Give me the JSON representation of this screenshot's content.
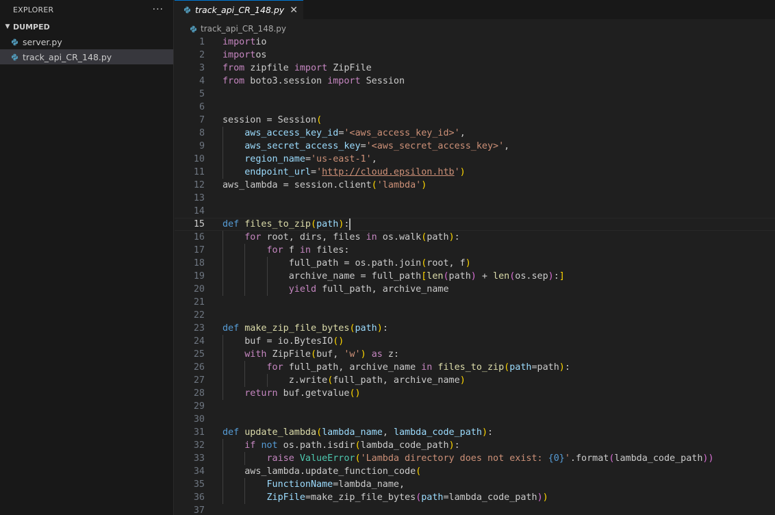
{
  "explorer": {
    "title": "EXPLORER",
    "more": "···",
    "folder": "DUMPED",
    "files": [
      "server.py",
      "track_api_CR_148.py"
    ]
  },
  "editor": {
    "tab_label": "track_api_CR_148.py",
    "breadcrumb": "track_api_CR_148.py"
  },
  "code": [
    [
      [
        "kw",
        "import"
      ],
      [
        "",
        "io"
      ]
    ],
    [
      [
        "kw",
        "import"
      ],
      [
        "",
        "os"
      ]
    ],
    [
      [
        "kw",
        "from"
      ],
      [
        "",
        " zipfile "
      ],
      [
        "kw",
        "import"
      ],
      [
        "",
        " ZipFile"
      ]
    ],
    [
      [
        "kw",
        "from"
      ],
      [
        "",
        " boto3.session "
      ],
      [
        "kw",
        "import"
      ],
      [
        "",
        " Session"
      ]
    ],
    [],
    [],
    [
      [
        "",
        "session = Session"
      ],
      [
        "b1",
        "("
      ]
    ],
    [
      [
        "",
        "    "
      ],
      [
        "prm",
        "aws_access_key_id"
      ],
      [
        "",
        "="
      ],
      [
        "str",
        "'<aws_access_key_id>'"
      ],
      [
        "",
        ","
      ]
    ],
    [
      [
        "",
        "    "
      ],
      [
        "prm",
        "aws_secret_access_key"
      ],
      [
        "",
        "="
      ],
      [
        "str",
        "'<aws_secret_access_key>'"
      ],
      [
        "",
        ","
      ]
    ],
    [
      [
        "",
        "    "
      ],
      [
        "prm",
        "region_name"
      ],
      [
        "",
        "="
      ],
      [
        "str",
        "'us-east-1'"
      ],
      [
        "",
        ","
      ]
    ],
    [
      [
        "",
        "    "
      ],
      [
        "prm",
        "endpoint_url"
      ],
      [
        "",
        "="
      ],
      [
        "str",
        "'"
      ],
      [
        "str link",
        "http://cloud.epsilon.htb"
      ],
      [
        "str",
        "'"
      ],
      [
        "b1",
        ")"
      ]
    ],
    [
      [
        "",
        "aws_lambda = session.client"
      ],
      [
        "b1",
        "("
      ],
      [
        "str",
        "'lambda'"
      ],
      [
        "b1",
        ")"
      ]
    ],
    [],
    [],
    [
      [
        "def",
        "def"
      ],
      [
        "",
        " "
      ],
      [
        "fn",
        "files_to_zip"
      ],
      [
        "b1",
        "("
      ],
      [
        "prm",
        "path"
      ],
      [
        "b1",
        ")"
      ],
      [
        "",
        ":"
      ]
    ],
    [
      [
        "",
        "    "
      ],
      [
        "kw",
        "for"
      ],
      [
        "",
        " root, dirs, files "
      ],
      [
        "kw",
        "in"
      ],
      [
        "",
        " os.walk"
      ],
      [
        "b1",
        "("
      ],
      [
        "",
        "path"
      ],
      [
        "b1",
        ")"
      ],
      [
        "",
        ":"
      ]
    ],
    [
      [
        "",
        "        "
      ],
      [
        "kw",
        "for"
      ],
      [
        "",
        " f "
      ],
      [
        "kw",
        "in"
      ],
      [
        "",
        " files:"
      ]
    ],
    [
      [
        "",
        "            full_path = os.path.join"
      ],
      [
        "b1",
        "("
      ],
      [
        "",
        "root, f"
      ],
      [
        "b1",
        ")"
      ]
    ],
    [
      [
        "",
        "            archive_name = full_path"
      ],
      [
        "b1",
        "["
      ],
      [
        "fn",
        "len"
      ],
      [
        "b2",
        "("
      ],
      [
        "",
        "path"
      ],
      [
        "b2",
        ")"
      ],
      [
        "",
        " + "
      ],
      [
        "fn",
        "len"
      ],
      [
        "b2",
        "("
      ],
      [
        "",
        "os.sep"
      ],
      [
        "b2",
        ")"
      ],
      [
        "",
        ":"
      ],
      [
        "b1",
        "]"
      ]
    ],
    [
      [
        "",
        "            "
      ],
      [
        "kw",
        "yield"
      ],
      [
        "",
        " full_path, archive_name"
      ]
    ],
    [],
    [],
    [
      [
        "def",
        "def"
      ],
      [
        "",
        " "
      ],
      [
        "fn",
        "make_zip_file_bytes"
      ],
      [
        "b1",
        "("
      ],
      [
        "prm",
        "path"
      ],
      [
        "b1",
        ")"
      ],
      [
        "",
        ":"
      ]
    ],
    [
      [
        "",
        "    buf = io.BytesIO"
      ],
      [
        "b1",
        "()"
      ]
    ],
    [
      [
        "",
        "    "
      ],
      [
        "kw",
        "with"
      ],
      [
        "",
        " ZipFile"
      ],
      [
        "b1",
        "("
      ],
      [
        "",
        "buf, "
      ],
      [
        "str",
        "'w'"
      ],
      [
        "b1",
        ")"
      ],
      [
        "",
        " "
      ],
      [
        "kw",
        "as"
      ],
      [
        "",
        " z:"
      ]
    ],
    [
      [
        "",
        "        "
      ],
      [
        "kw",
        "for"
      ],
      [
        "",
        " full_path, archive_name "
      ],
      [
        "kw",
        "in"
      ],
      [
        "",
        " "
      ],
      [
        "fn",
        "files_to_zip"
      ],
      [
        "b1",
        "("
      ],
      [
        "prm",
        "path"
      ],
      [
        "",
        "=path"
      ],
      [
        "b1",
        ")"
      ],
      [
        "",
        ":"
      ]
    ],
    [
      [
        "",
        "            z.write"
      ],
      [
        "b1",
        "("
      ],
      [
        "",
        "full_path, archive_name"
      ],
      [
        "b1",
        ")"
      ]
    ],
    [
      [
        "",
        "    "
      ],
      [
        "kw",
        "return"
      ],
      [
        "",
        " buf.getvalue"
      ],
      [
        "b1",
        "()"
      ]
    ],
    [],
    [],
    [
      [
        "def",
        "def"
      ],
      [
        "",
        " "
      ],
      [
        "fn",
        "update_lambda"
      ],
      [
        "b1",
        "("
      ],
      [
        "prm",
        "lambda_name"
      ],
      [
        "",
        ", "
      ],
      [
        "prm",
        "lambda_code_path"
      ],
      [
        "b1",
        ")"
      ],
      [
        "",
        ":"
      ]
    ],
    [
      [
        "",
        "    "
      ],
      [
        "kw",
        "if"
      ],
      [
        "",
        " "
      ],
      [
        "def",
        "not"
      ],
      [
        "",
        " os.path.isdir"
      ],
      [
        "b1",
        "("
      ],
      [
        "",
        "lambda_code_path"
      ],
      [
        "b1",
        ")"
      ],
      [
        "",
        ":"
      ]
    ],
    [
      [
        "",
        "        "
      ],
      [
        "kw",
        "raise"
      ],
      [
        "",
        " "
      ],
      [
        "cls",
        "ValueError"
      ],
      [
        "b1",
        "("
      ],
      [
        "str",
        "'Lambda directory does not exist: "
      ],
      [
        "def",
        "{0}"
      ],
      [
        "str",
        "'"
      ],
      [
        "",
        ".format"
      ],
      [
        "b2",
        "("
      ],
      [
        "",
        "lambda_code_path"
      ],
      [
        "b2",
        "))"
      ]
    ],
    [
      [
        "",
        "    aws_lambda.update_function_code"
      ],
      [
        "b1",
        "("
      ]
    ],
    [
      [
        "",
        "        "
      ],
      [
        "prm",
        "FunctionName"
      ],
      [
        "",
        "=lambda_name,"
      ]
    ],
    [
      [
        "",
        "        "
      ],
      [
        "prm",
        "ZipFile"
      ],
      [
        "",
        "=make_zip_file_bytes"
      ],
      [
        "b2",
        "("
      ],
      [
        "prm",
        "path"
      ],
      [
        "",
        "=lambda_code_path"
      ],
      [
        "b2",
        ")"
      ],
      [
        "b1",
        ")"
      ]
    ],
    []
  ],
  "current_line": 15
}
